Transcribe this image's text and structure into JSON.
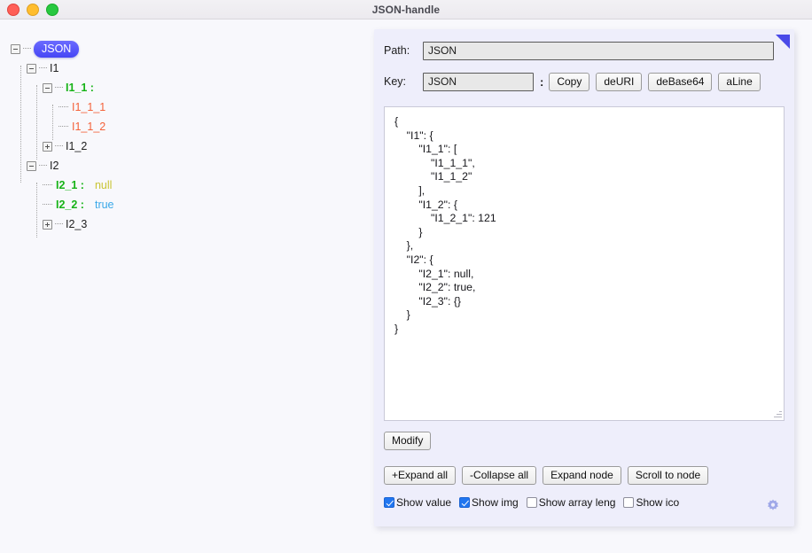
{
  "window": {
    "title": "JSON-handle",
    "traffic_lights": [
      "close-red",
      "minimize-yellow",
      "maximize-green"
    ]
  },
  "tree": {
    "root": {
      "label": "JSON",
      "toggle": "minus"
    },
    "nodes": [
      {
        "key": "I1",
        "toggle": "minus",
        "value": null,
        "value_type": "none",
        "key_style": "plain",
        "depth": 1
      },
      {
        "key": "I1_1 :",
        "toggle": "minus",
        "value": null,
        "value_type": "none",
        "key_style": "green",
        "depth": 2
      },
      {
        "key": "I1_1_1",
        "toggle": "leaf",
        "value": null,
        "value_type": "none",
        "key_style": "orange",
        "depth": 3
      },
      {
        "key": "I1_1_2",
        "toggle": "leaf",
        "value": null,
        "value_type": "none",
        "key_style": "orange",
        "depth": 3
      },
      {
        "key": "I1_2",
        "toggle": "plus",
        "value": null,
        "value_type": "none",
        "key_style": "plain",
        "depth": 2
      },
      {
        "key": "I2",
        "toggle": "minus",
        "value": null,
        "value_type": "none",
        "key_style": "plain",
        "depth": 1
      },
      {
        "key": "I2_1 :",
        "toggle": "leaf",
        "value": "null",
        "value_type": "null",
        "key_style": "green",
        "depth": 2
      },
      {
        "key": "I2_2 :",
        "toggle": "leaf",
        "value": "true",
        "value_type": "boolean",
        "key_style": "green",
        "depth": 2
      },
      {
        "key": "I2_3",
        "toggle": "plus",
        "value": null,
        "value_type": "none",
        "key_style": "plain",
        "depth": 2
      }
    ]
  },
  "panel": {
    "path": {
      "label": "Path:",
      "value": "JSON"
    },
    "key": {
      "label": "Key:",
      "value": "JSON",
      "separator": ":"
    },
    "key_buttons": [
      {
        "label": "Copy"
      },
      {
        "label": "deURI"
      },
      {
        "label": "deBase64"
      },
      {
        "label": "aLine"
      }
    ],
    "json_text": "{\n    \"I1\": {\n        \"I1_1\": [\n            \"I1_1_1\",\n            \"I1_1_2\"\n        ],\n        \"I1_2\": {\n            \"I1_2_1\": 121\n        }\n    },\n    \"I2\": {\n        \"I2_1\": null,\n        \"I2_2\": true,\n        \"I2_3\": {}\n    }\n}",
    "modify_button": {
      "label": "Modify"
    },
    "action_buttons": [
      {
        "label": "+Expand all"
      },
      {
        "label": "-Collapse all"
      },
      {
        "label": "Expand node"
      },
      {
        "label": "Scroll to node"
      }
    ],
    "checkboxes": [
      {
        "label": "Show value",
        "checked": true
      },
      {
        "label": "Show img",
        "checked": true
      },
      {
        "label": "Show array leng",
        "checked": false
      },
      {
        "label": "Show ico",
        "checked": false
      }
    ],
    "gear_icon": "gear-icon",
    "corner_marker": "blue-triangle-marker"
  },
  "colors": {
    "accent_blue": "#4a4ae8",
    "key_green": "#17b317",
    "array_orange": "#f4623a",
    "null_yellow": "#c9c534",
    "true_blue": "#3aa8e8",
    "panel_bg": "#eeeefb",
    "checkbox_checked": "#2176f0"
  }
}
